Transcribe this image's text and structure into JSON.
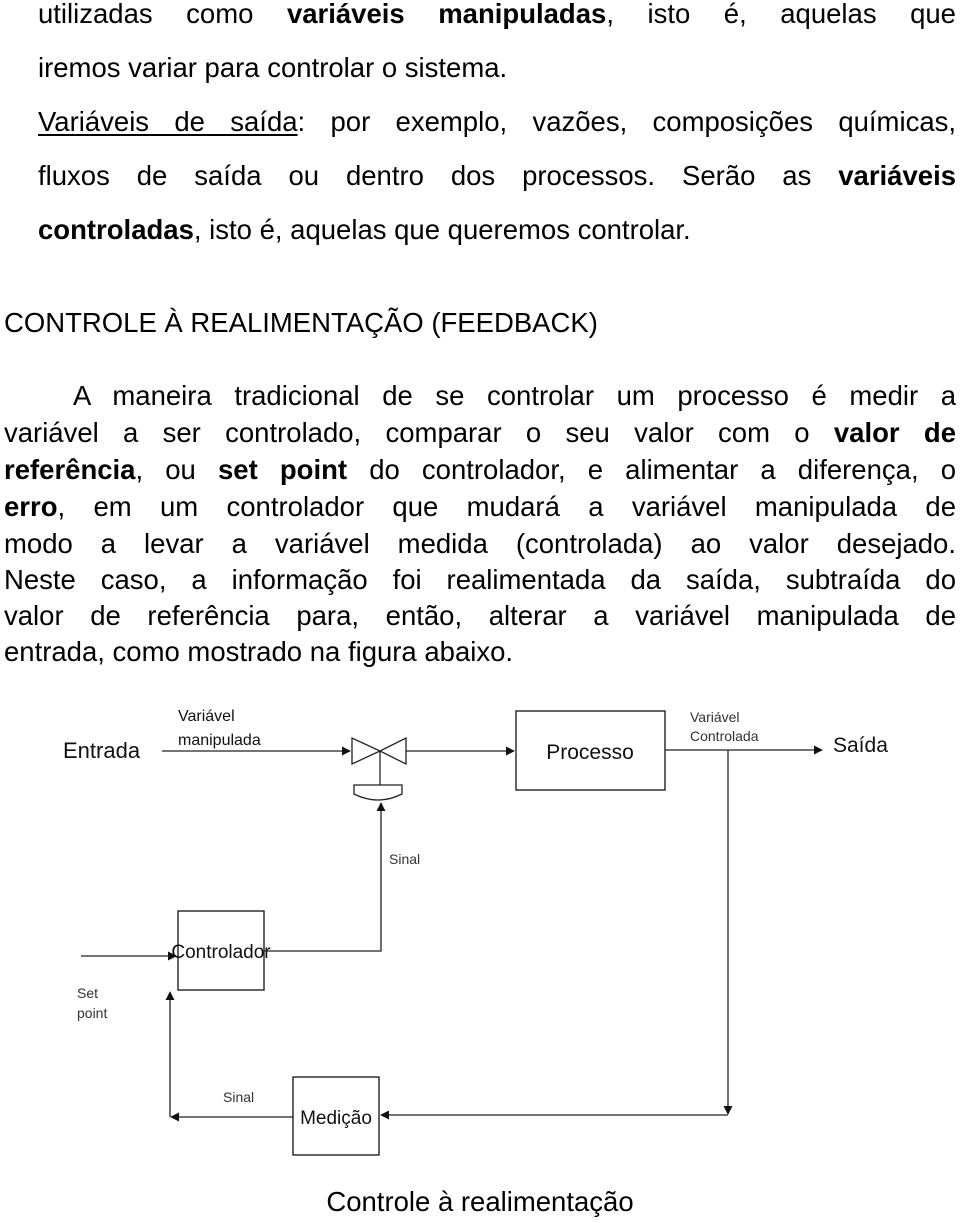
{
  "intro_paragraph": {
    "line1": {
      "p1": "utilizadas como ",
      "b1": "variáveis manipuladas",
      "p2": ", isto é, aquelas que"
    },
    "line2": "iremos variar para controlar o sistema.",
    "line3": {
      "u1": "Variáveis de saída",
      "p1": ": por exemplo, vazões, composições químicas,"
    },
    "line4": {
      "p1": "fluxos de saída ou dentro dos processos. Serão as ",
      "b1": "variáveis"
    },
    "line5": {
      "b1": "controladas",
      "p1": ", isto é, aquelas que queremos controlar."
    }
  },
  "section": {
    "heading": "CONTROLE À REALIMENTAÇÃO (FEEDBACK)",
    "paragraph": {
      "line1": "A maneira tradicional de se controlar um processo é medir a",
      "line2": {
        "p1": "variável a ser controlado, comparar o seu valor com o ",
        "b1": "valor de"
      },
      "line3": {
        "b1": "referência",
        "p1": ", ou ",
        "b2": "set point",
        "p2": " do controlador, e alimentar a diferença, o"
      },
      "line4": {
        "b1": "erro",
        "p1": ", em um controlador que mudará a variável manipulada de"
      },
      "line5": "modo a levar a variável medida (controlada) ao valor desejado.",
      "line6": "Neste caso, a informação foi realimentada da saída, subtraída do",
      "line7": "valor de referência para, então, alterar a variável manipulada de",
      "line8": "entrada, como mostrado na figura abaixo."
    }
  },
  "diagram": {
    "input_label": "Entrada",
    "manipulated_label_1": "Variável",
    "manipulated_label_2": "manipulada",
    "process_label": "Processo",
    "controlled_label_1": "Variável",
    "controlled_label_2": "Controlada",
    "output_label": "Saída",
    "signal_label_upper": "Sinal",
    "controller_label": "Controlador",
    "setpoint_label_1": "Set",
    "setpoint_label_2": "point",
    "signal_label_lower": "Sinal",
    "measurement_label": "Medição"
  },
  "caption": "Controle à realimentação"
}
